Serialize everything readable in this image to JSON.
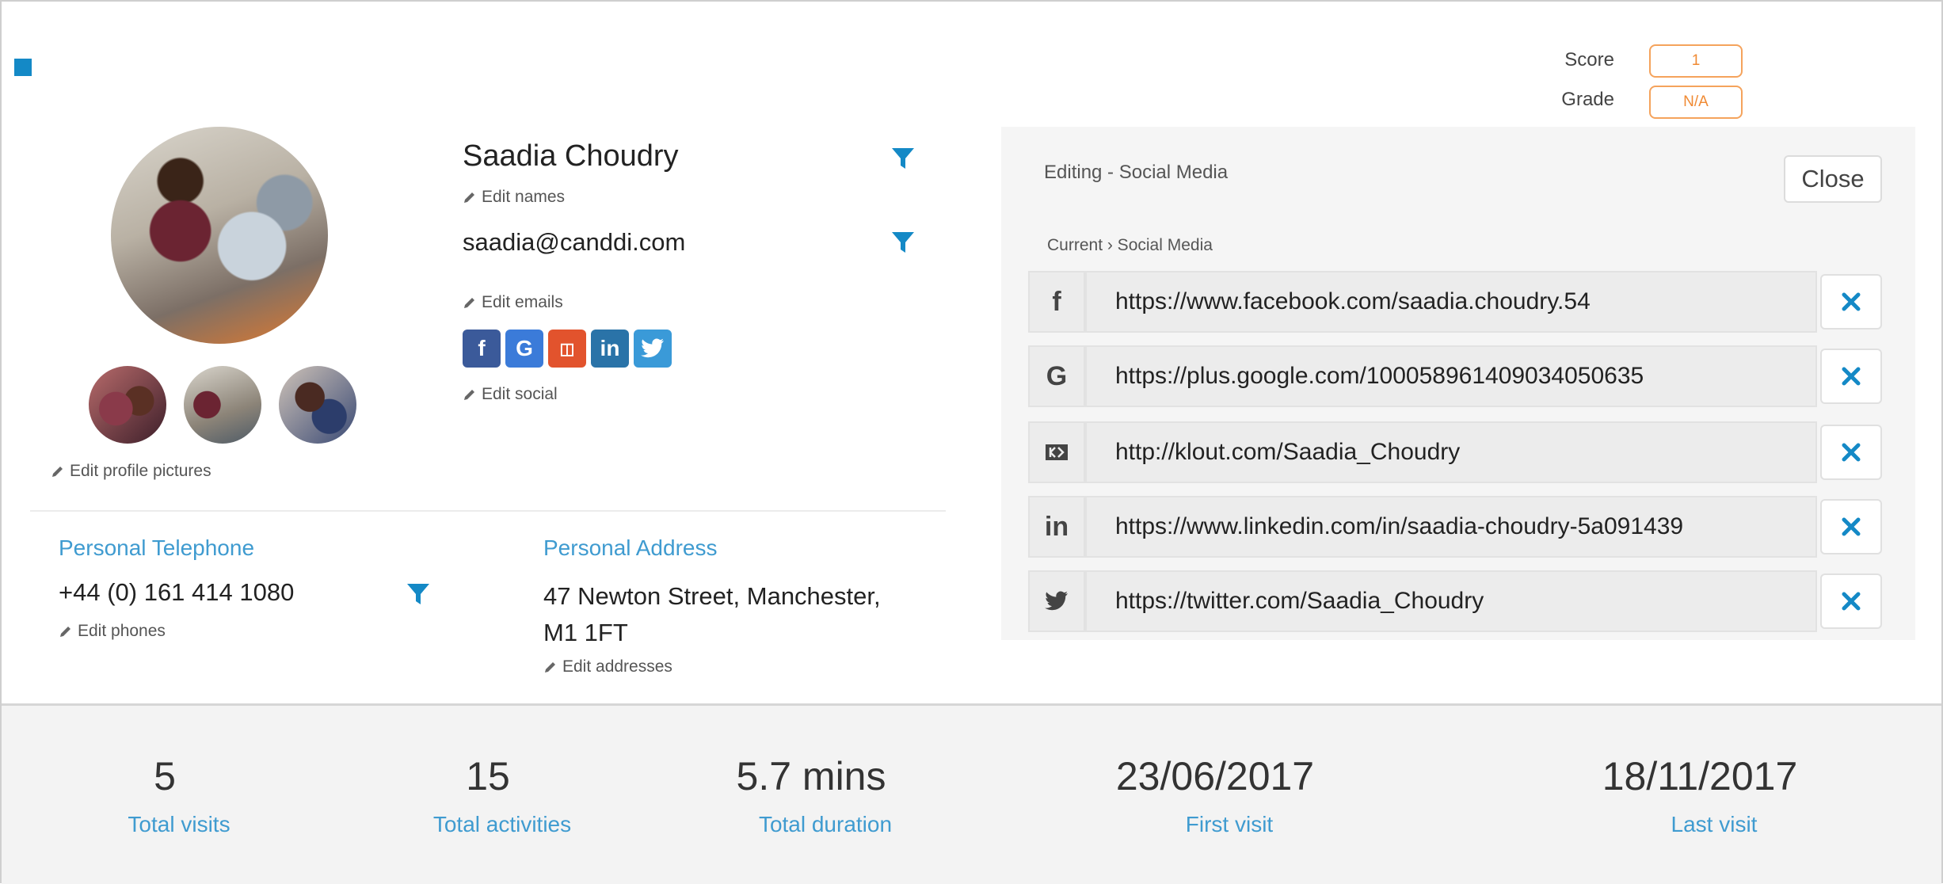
{
  "header": {
    "score_label": "Score",
    "score_value": "1",
    "grade_label": "Grade",
    "grade_value": "N/A"
  },
  "profile": {
    "name": "Saadia Choudry",
    "edit_names": "Edit names",
    "email": "saadia@canddi.com",
    "edit_emails": "Edit emails",
    "edit_social": "Edit social",
    "edit_profile_pictures": "Edit profile pictures",
    "social_icons": [
      "f",
      "G",
      "kl",
      "in",
      "tw"
    ]
  },
  "contact": {
    "telephone_label": "Personal Telephone",
    "telephone": "+44 (0) 161 414 1080",
    "edit_phones": "Edit phones",
    "address_label": "Personal Address",
    "address_line1": "47 Newton Street, Manchester,",
    "address_line2": "M1 1FT",
    "edit_addresses": "Edit addresses"
  },
  "panel": {
    "title": "Editing - Social Media",
    "close_label": "Close",
    "breadcrumb": "Current › Social Media",
    "links": [
      {
        "icon": "facebook-icon",
        "glyph": "f",
        "url": "https://www.facebook.com/saadia.choudry.54"
      },
      {
        "icon": "google-plus-icon",
        "glyph": "G",
        "url": "https://plus.google.com/100058961409034050635"
      },
      {
        "icon": "klout-icon",
        "glyph": "K",
        "url": "http://klout.com/Saadia_Choudry"
      },
      {
        "icon": "linkedin-icon",
        "glyph": "in",
        "url": "https://www.linkedin.com/in/saadia-choudry-5a091439"
      },
      {
        "icon": "twitter-icon",
        "glyph": "t",
        "url": "https://twitter.com/Saadia_Choudry"
      }
    ]
  },
  "stats": [
    {
      "value": "5",
      "label": "Total visits"
    },
    {
      "value": "15",
      "label": "Total activities"
    },
    {
      "value": "5.7 mins",
      "label": "Total duration"
    },
    {
      "value": "23/06/2017",
      "label": "First visit"
    },
    {
      "value": "18/11/2017",
      "label": "Last visit"
    }
  ],
  "colors": {
    "accent": "#1489c6",
    "link": "#3f9bd0",
    "score_border": "#f5a35c"
  }
}
